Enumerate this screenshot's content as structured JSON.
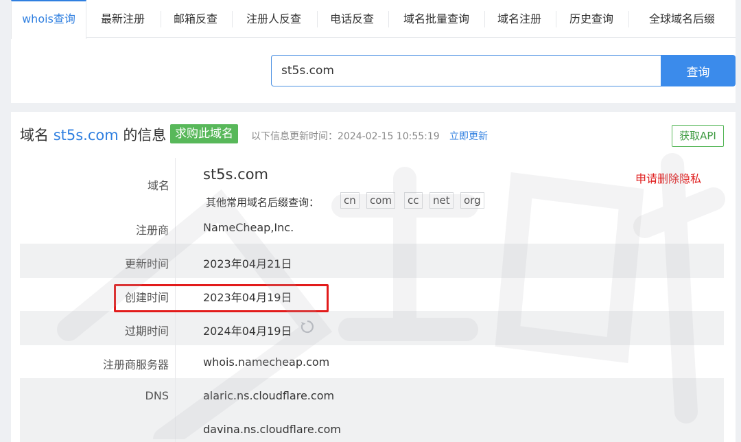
{
  "tabs": [
    "whois查询",
    "最新注册",
    "邮箱反查",
    "注册人反查",
    "电话反查",
    "域名批量查询",
    "域名注册",
    "历史查询",
    "全球域名后缀"
  ],
  "search": {
    "value": "st5s.com",
    "button": "查询"
  },
  "header": {
    "prefix": "域名",
    "domain": "st5s.com",
    "suffix": "的信息",
    "buy_badge": "求购此域名",
    "update_text": "以下信息更新时间：2024-02-15 10:55:19",
    "update_link": "立即更新",
    "api_button": "获取API"
  },
  "domain_row": {
    "label": "域名",
    "value": "st5s.com",
    "privacy_link": "申请删除隐私",
    "suffix_label": "其他常用域名后缀查询：",
    "suffixes": [
      "cn",
      "com",
      "cc",
      "net",
      "org"
    ]
  },
  "rows": [
    {
      "label": "注册商",
      "value": "NameCheap,Inc."
    },
    {
      "label": "更新时间",
      "value": "2023年04月21日"
    },
    {
      "label": "创建时间",
      "value": "2023年04月19日"
    },
    {
      "label": "过期时间",
      "value": "2024年04月19日"
    },
    {
      "label": "注册商服务器",
      "value": "whois.namecheap.com"
    },
    {
      "label": "DNS",
      "value": "alaric.ns.cloudflare.com"
    },
    {
      "label": "",
      "value": "davina.ns.cloudflare.com"
    }
  ],
  "icons": {
    "refresh": "refresh-icon"
  },
  "colors": {
    "accent": "#2f7fe0",
    "buy": "#58b85a",
    "danger": "#e02020",
    "highlight": "#e21b1b"
  }
}
